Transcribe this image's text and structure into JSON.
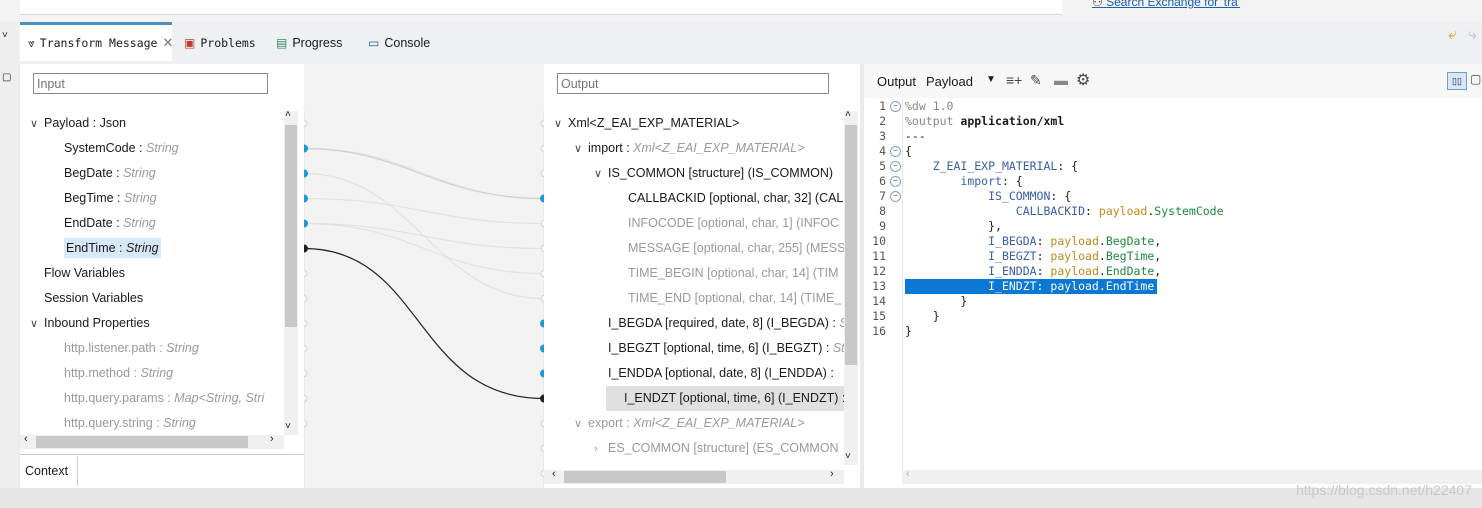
{
  "top": {
    "search_link": "Search Exchange for 'tra'"
  },
  "tabs": [
    {
      "label": "Transform Message",
      "icon": "transform-icon",
      "active": true
    },
    {
      "label": "Problems",
      "icon": "problems-icon"
    },
    {
      "label": "Progress",
      "icon": "progress-icon"
    },
    {
      "label": "Console",
      "icon": "console-icon"
    }
  ],
  "input": {
    "search_placeholder": "Input",
    "tree": [
      {
        "name": "Payload : Json",
        "level": 0,
        "caret": "v"
      },
      {
        "name": "SystemCode",
        "type": "String",
        "level": 1
      },
      {
        "name": "BegDate",
        "type": "String",
        "level": 1
      },
      {
        "name": "BegTime",
        "type": "String",
        "level": 1
      },
      {
        "name": "EndDate",
        "type": "String",
        "level": 1
      },
      {
        "name": "EndTime",
        "type": "String",
        "level": 1,
        "selected": true
      },
      {
        "name": "Flow Variables",
        "level": 0
      },
      {
        "name": "Session Variables",
        "level": 0
      },
      {
        "name": "Inbound Properties",
        "level": 0,
        "caret": "v"
      },
      {
        "name": "http.listener.path",
        "type": "String",
        "level": 1,
        "dim": true
      },
      {
        "name": "http.method",
        "type": "String",
        "level": 1,
        "dim": true
      },
      {
        "name": "http.query.params",
        "type": "Map<String, Stri",
        "level": 1,
        "dim": true
      },
      {
        "name": "http.query.string",
        "type": "String",
        "level": 1,
        "dim": true
      }
    ],
    "context_tab": "Context"
  },
  "output": {
    "search_placeholder": "Output",
    "tree": [
      {
        "name": "Xml<Z_EAI_EXP_MATERIAL>",
        "level": 0,
        "caret": "v"
      },
      {
        "name": "import",
        "type": "Xml<Z_EAI_EXP_MATERIAL>",
        "level": 1,
        "caret": "v"
      },
      {
        "name": "IS_COMMON [structure] (IS_COMMON)",
        "level": 2,
        "caret": "v"
      },
      {
        "name": "CALLBACKID [optional, char, 32] (CAL",
        "level": 3
      },
      {
        "name": "INFOCODE [optional, char, 1] (INFOC",
        "level": 3,
        "dim": true
      },
      {
        "name": "MESSAGE [optional, char, 255] (MESS",
        "level": 3,
        "dim": true
      },
      {
        "name": "TIME_BEGIN [optional, char, 14] (TIM",
        "level": 3,
        "dim": true
      },
      {
        "name": "TIME_END [optional, char, 14] (TIME_",
        "level": 3,
        "dim": true
      },
      {
        "name": "I_BEGDA [required, date, 8] (I_BEGDA) :",
        "level": 2,
        "suffix": "S"
      },
      {
        "name": "I_BEGZT [optional, time, 6] (I_BEGZT) :",
        "level": 2,
        "suffix": "St"
      },
      {
        "name": "I_ENDDA [optional, date, 8] (I_ENDDA) :",
        "level": 2,
        "suffix": ""
      },
      {
        "name": "I_ENDZT [optional, time, 6] (I_ENDZT) :",
        "level": 2,
        "suffix": "S",
        "selected": true
      },
      {
        "name": "export",
        "type": "Xml<Z_EAI_EXP_MATERIAL>",
        "level": 1,
        "caret": "v",
        "dim": true
      },
      {
        "name": "ES_COMMON [structure] (ES_COMMON",
        "level": 2,
        "caret": ">",
        "dim": true
      }
    ]
  },
  "editor": {
    "toolbar": {
      "label_output": "Output",
      "label_payload": "Payload"
    },
    "lines": [
      {
        "n": "1",
        "fold": true,
        "html": "<span class='gray'>%dw 1.0</span>"
      },
      {
        "n": "2",
        "html": "<span class='gray'>%output</span> <b>application/xml</b>"
      },
      {
        "n": "3",
        "html": "---"
      },
      {
        "n": "4",
        "fold": true,
        "html": "{"
      },
      {
        "n": "5",
        "fold": true,
        "html": "    <span class='key'>Z_EAI_EXP_MATERIAL</span>: {"
      },
      {
        "n": "6",
        "fold": true,
        "html": "        <span class='key'>import</span>: {"
      },
      {
        "n": "7",
        "fold": true,
        "html": "            <span class='key'>IS_COMMON</span>: {"
      },
      {
        "n": "8",
        "html": "                <span class='key'>CALLBACKID</span>: <span class='pay'>payload</span>.<span class='fld'>SystemCode</span>"
      },
      {
        "n": "9",
        "html": "            },"
      },
      {
        "n": "10",
        "html": "            <span class='key'>I_BEGDA</span>: <span class='pay'>payload</span>.<span class='fld'>BegDate</span>,"
      },
      {
        "n": "11",
        "html": "            <span class='key'>I_BEGZT</span>: <span class='pay'>payload</span>.<span class='fld'>BegTime</span>,"
      },
      {
        "n": "12",
        "html": "            <span class='key'>I_ENDDA</span>: <span class='pay'>payload</span>.<span class='fld'>EndDate</span>,"
      },
      {
        "n": "13",
        "selected": true,
        "html": "            I_ENDZT: payload.EndTime"
      },
      {
        "n": "14",
        "html": "        }"
      },
      {
        "n": "15",
        "html": "    }"
      },
      {
        "n": "16",
        "html": "}"
      }
    ]
  },
  "watermark": "https://blog.csdn.net/h22407"
}
